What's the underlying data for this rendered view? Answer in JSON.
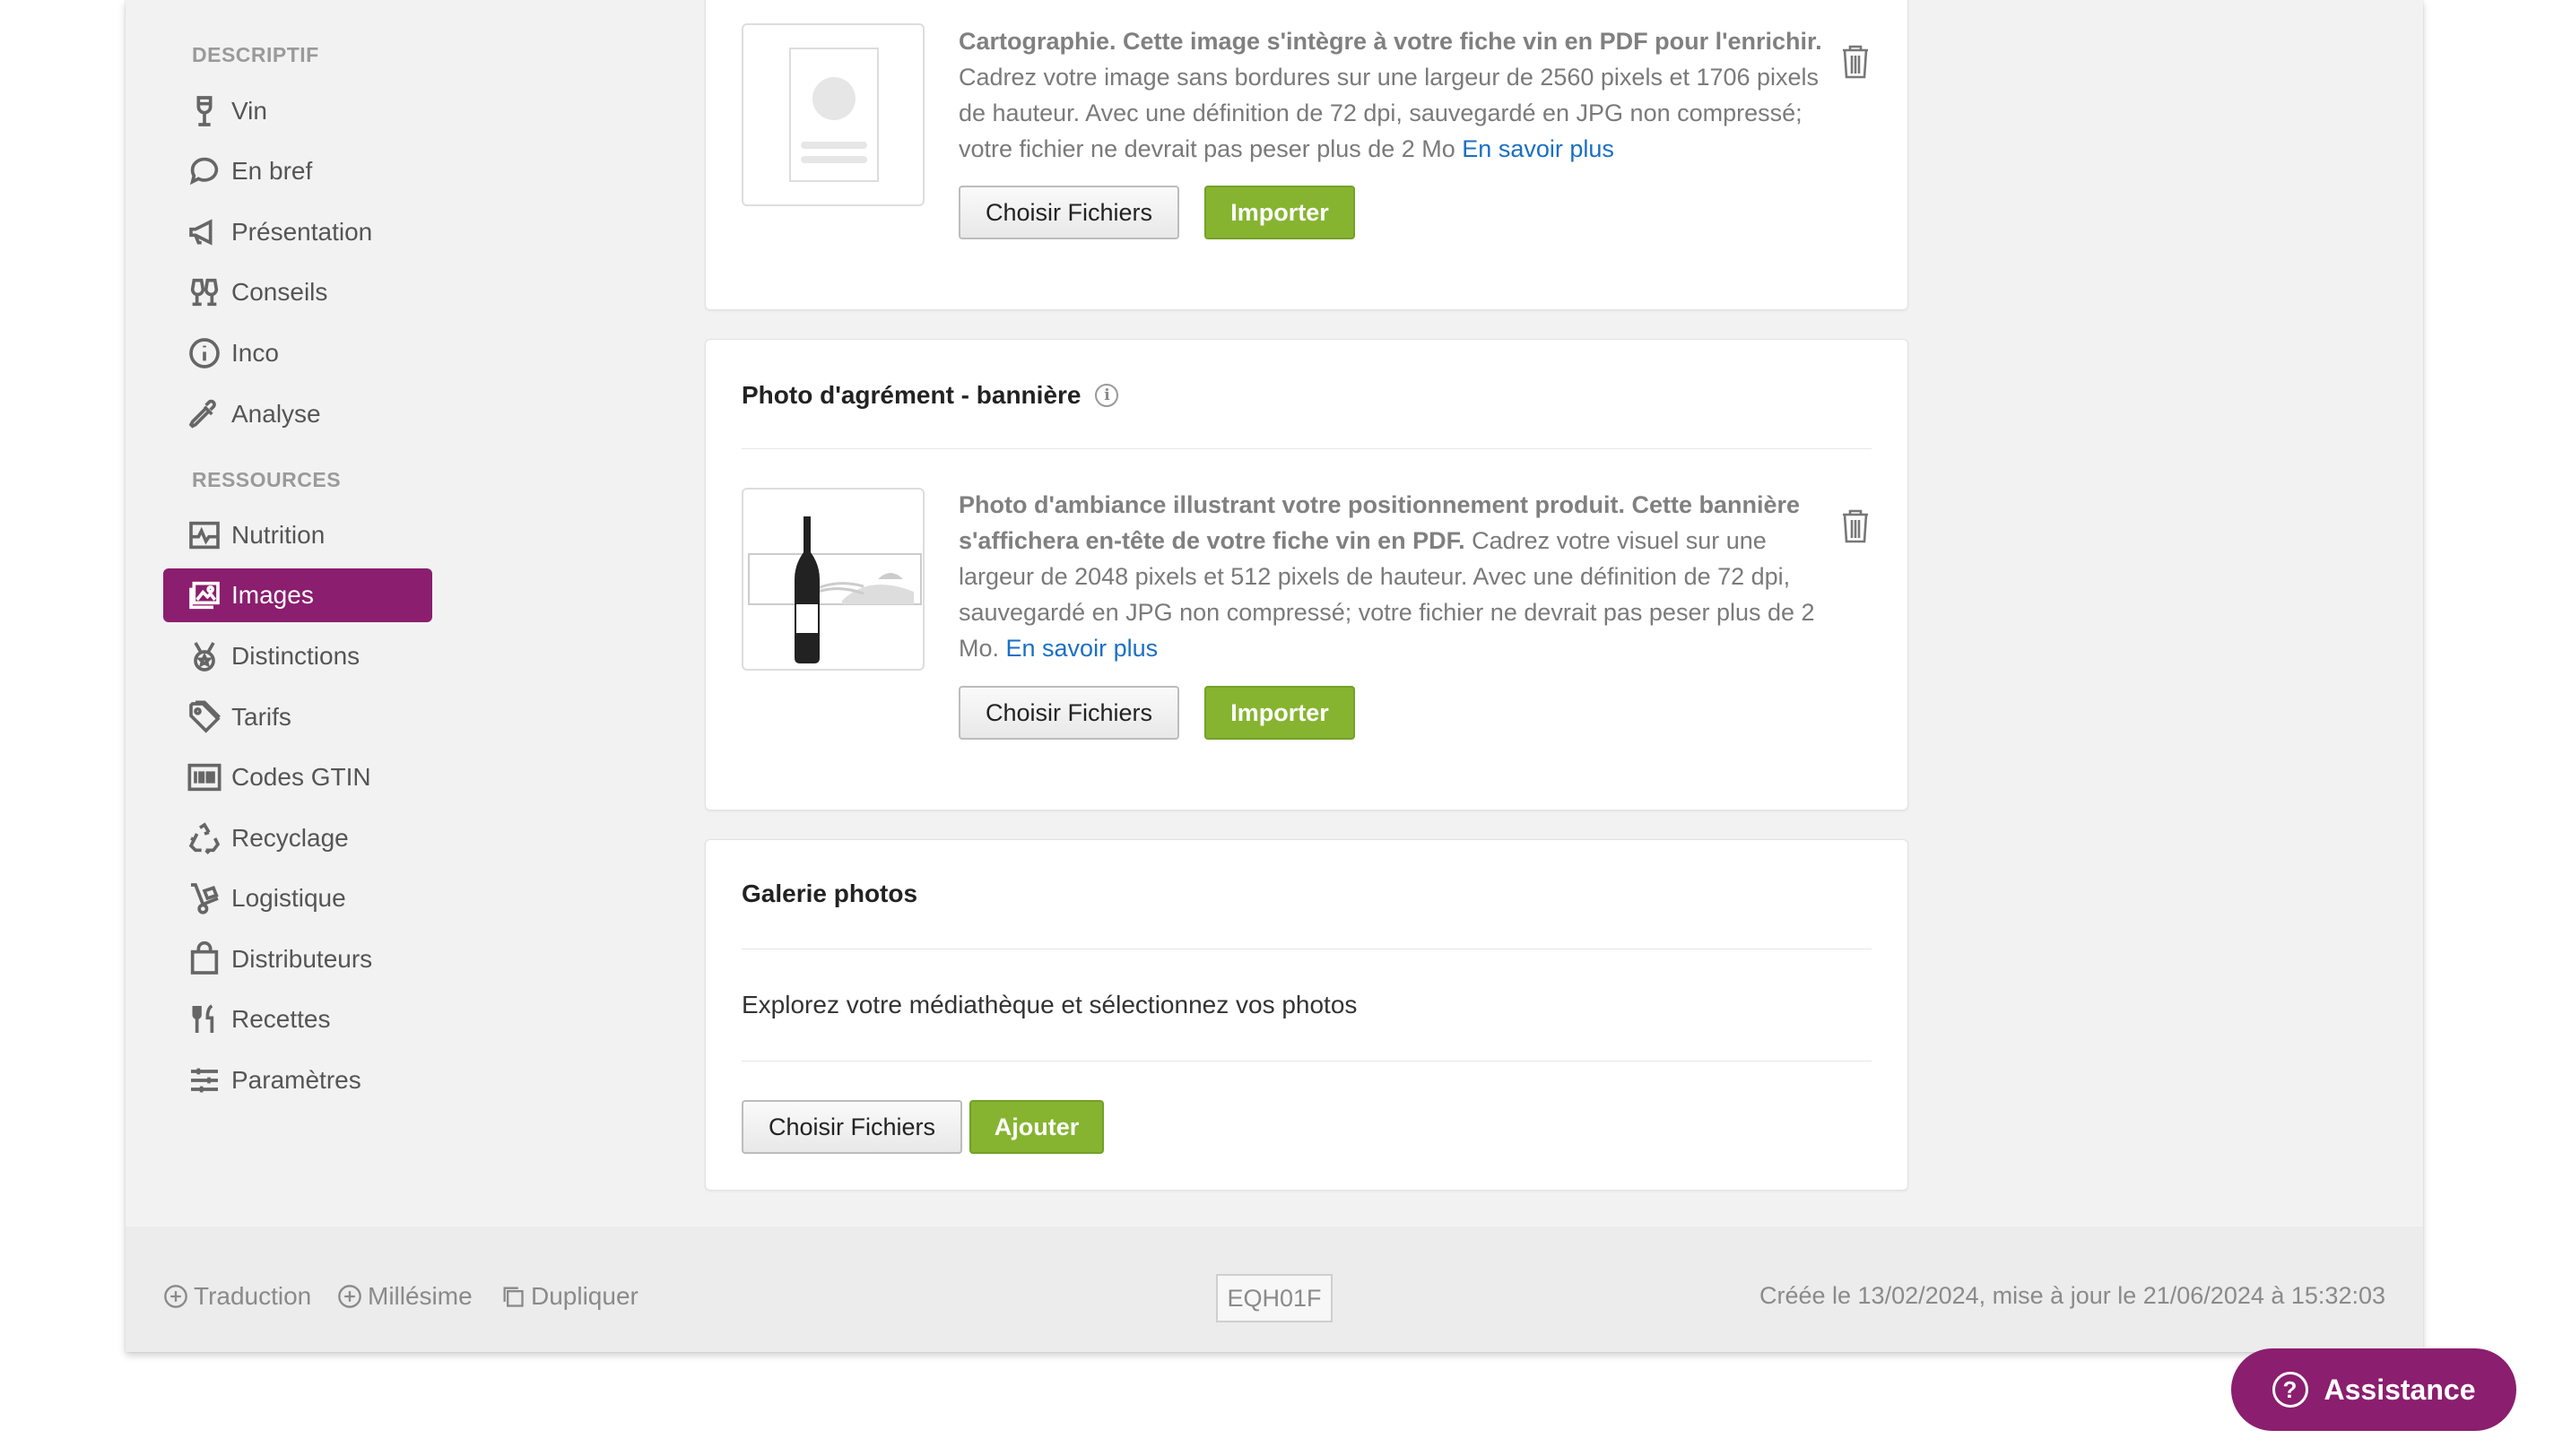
{
  "sidebar": {
    "section_descriptif": "DESCRIPTIF",
    "section_ressources": "RESSOURCES",
    "descriptif_items": [
      {
        "label": "Vin",
        "icon": "wine-glass-icon"
      },
      {
        "label": "En bref",
        "icon": "speech-bubble-icon"
      },
      {
        "label": "Présentation",
        "icon": "megaphone-icon"
      },
      {
        "label": "Conseils",
        "icon": "glasses-toast-icon"
      },
      {
        "label": "Inco",
        "icon": "info-circle-icon"
      },
      {
        "label": "Analyse",
        "icon": "pipette-icon"
      }
    ],
    "ressources_items": [
      {
        "label": "Nutrition",
        "icon": "pulse-chart-icon"
      },
      {
        "label": "Images",
        "icon": "images-icon",
        "active": true
      },
      {
        "label": "Distinctions",
        "icon": "medal-icon"
      },
      {
        "label": "Tarifs",
        "icon": "price-tag-icon"
      },
      {
        "label": "Codes GTIN",
        "icon": "barcode-icon"
      },
      {
        "label": "Recyclage",
        "icon": "recycle-icon"
      },
      {
        "label": "Logistique",
        "icon": "hand-truck-icon"
      },
      {
        "label": "Distributeurs",
        "icon": "shopping-bag-icon"
      },
      {
        "label": "Recettes",
        "icon": "utensils-icon"
      },
      {
        "label": "Paramètres",
        "icon": "sliders-icon"
      }
    ],
    "active_color": "#8b1e6e"
  },
  "card_carto": {
    "desc_bold": "Cartographie. Cette image s'intègre à votre fiche vin en PDF pour l'enrichir.",
    "desc_text": " Cadrez votre image sans bordures sur une largeur de 2560 pixels et 1706 pixels de hauteur. Avec une définition de 72 dpi, sauvegardé en JPG non compressé; votre fichier ne devrait pas peser plus de 2 Mo ",
    "link": "En savoir plus",
    "choose_label": "Choisir Fichiers",
    "import_label": "Importer"
  },
  "card_banner": {
    "title": "Photo d'agrément - bannière",
    "desc_bold": "Photo d'ambiance illustrant votre positionnement produit. Cette bannière s'affichera en-tête de votre fiche vin en PDF.",
    "desc_text": " Cadrez votre visuel sur une largeur de 2048 pixels et 512 pixels de hauteur. Avec une définition de 72 dpi, sauvegardé en JPG non compressé; votre fichier ne devrait pas peser plus de 2 Mo. ",
    "link": "En savoir plus",
    "choose_label": "Choisir Fichiers",
    "import_label": "Importer"
  },
  "card_gallery": {
    "title": "Galerie photos",
    "text": "Explorez votre médiathèque et sélectionnez vos photos",
    "choose_label": "Choisir Fichiers",
    "add_label": "Ajouter"
  },
  "footer": {
    "traduction": "Traduction",
    "millesime": "Millésime",
    "dupliquer": "Dupliquer",
    "code": "EQH01F",
    "timestamp": "Créée le 13/02/2024, mise à jour le 21/06/2024 à 15:32:03"
  },
  "assist_label": "Assistance",
  "colors": {
    "accent": "#8b1e6e",
    "green": "#86b431",
    "link": "#1a6fc4"
  }
}
